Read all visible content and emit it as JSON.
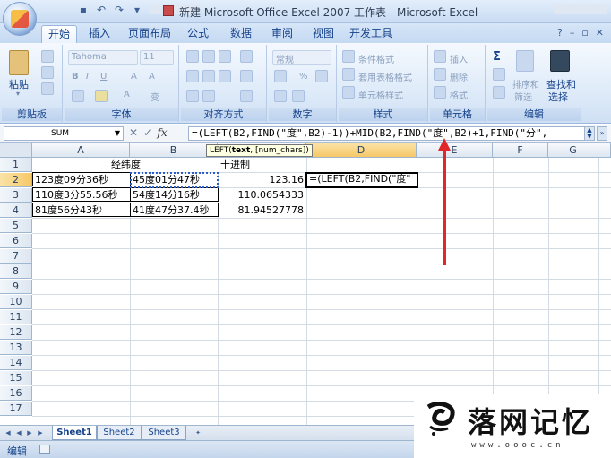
{
  "window": {
    "title": "新建 Microsoft Office Excel 2007 工作表 - Microsoft Excel"
  },
  "tabs": [
    "开始",
    "插入",
    "页面布局",
    "公式",
    "数据",
    "审阅",
    "视图",
    "开发工具"
  ],
  "ribbon": {
    "clipboard": {
      "label": "剪贴板",
      "paste": "粘贴"
    },
    "font": {
      "label": "字体",
      "font_name": "Tahoma",
      "font_size": "11",
      "bold": "B",
      "italic": "I",
      "underline": "U",
      "grow": "A",
      "shrink": "A",
      "color": "A",
      "phonetic": "变"
    },
    "alignment": {
      "label": "对齐方式"
    },
    "number": {
      "label": "数字",
      "format": "常规",
      "percent": "%"
    },
    "styles": {
      "label": "样式",
      "conditional": "条件格式",
      "table": "套用表格格式",
      "cell_styles": "单元格样式"
    },
    "cells": {
      "label": "单元格",
      "insert": "插入",
      "delete": "删除",
      "format": "格式"
    },
    "editing": {
      "label": "编辑",
      "sigma": "Σ",
      "sort": "排序和",
      "filter": "筛选",
      "find": "查找和",
      "select": "选择"
    }
  },
  "formula_bar": {
    "name_box": "SUM",
    "cancel": "✕",
    "enter": "✓",
    "fx": "fx",
    "formula": "=(LEFT(B2,FIND(\"度\",B2)-1))+MID(B2,FIND(\"度\",B2)+1,FIND(\"分\","
  },
  "grid": {
    "columns": [
      "A",
      "B",
      "C",
      "D",
      "E",
      "F",
      "G"
    ],
    "rows": [
      "1",
      "2",
      "3",
      "4",
      "5",
      "6",
      "7",
      "8",
      "9",
      "10",
      "11",
      "12",
      "13",
      "14",
      "15",
      "16",
      "17"
    ],
    "cells": {
      "A1B1": "经纬度",
      "C1": "十进制",
      "A2": "123度09分36秒",
      "B2": "45度01分47秒",
      "C2": "123.16",
      "D2": "=(LEFT(B2,FIND(\"度\"",
      "A3": "110度3分55.56秒",
      "B3": "54度14分16秒",
      "C3": "110.0654333",
      "A4": "81度56分43秒",
      "B4": "41度47分37.4秒",
      "C4": "81.94527778"
    },
    "tooltip": {
      "fn": "LEFT(",
      "arg1": "text",
      "rest": ", [num_chars])"
    }
  },
  "sheet_tabs": [
    "Sheet1",
    "Sheet2",
    "Sheet3"
  ],
  "active_sheet": "Sheet1",
  "status": {
    "mode": "编辑"
  },
  "watermark": {
    "text": "落网记忆",
    "url": "www.oooc.cn"
  },
  "colors": {
    "accent": "#15428b",
    "ribbon": "#dfebf9",
    "arrow": "#e0272a"
  }
}
